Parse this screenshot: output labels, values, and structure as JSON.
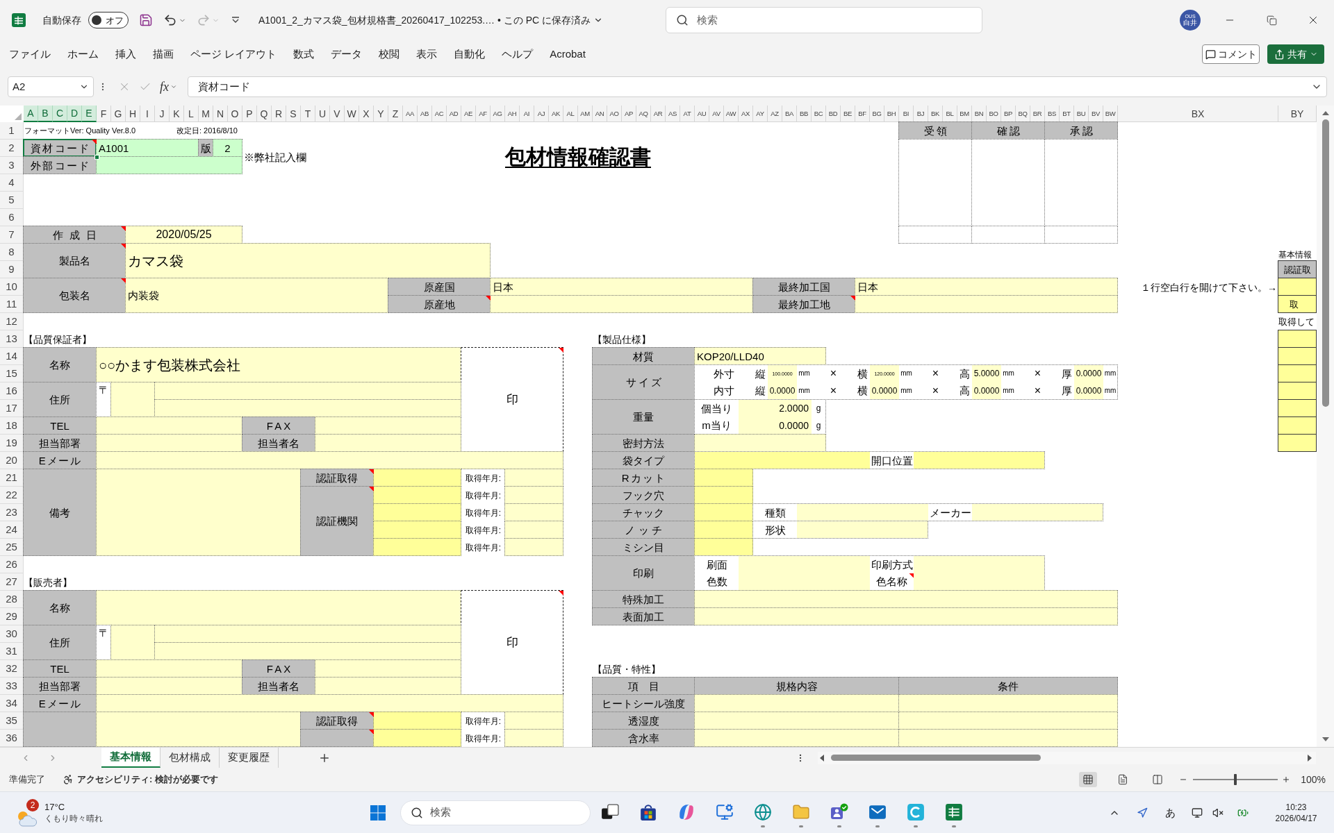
{
  "window": {
    "autosave": {
      "label": "自動保存",
      "toggle_label": "オフ",
      "on": false
    },
    "redo": {
      "disabled": true
    },
    "title": "A1001_2_カマス袋_包材規格書_20260417_102253.… • この PC に保存済み",
    "search_placeholder": "検索",
    "avatar": {
      "initials": "OUS",
      "name": "白井"
    }
  },
  "ribbon": {
    "tabs": [
      "ファイル",
      "ホーム",
      "挿入",
      "描画",
      "ページ レイアウト",
      "数式",
      "データ",
      "校閲",
      "表示",
      "自動化",
      "ヘルプ",
      "Acrobat"
    ],
    "comment_button": "コメント",
    "share_button": "共有"
  },
  "formula_bar": {
    "name_box": "A2",
    "edit_disabled": true,
    "function_label": "fx",
    "formula": "資材コード"
  },
  "column_headers": [
    {
      "label": "A",
      "selected": true
    },
    {
      "label": "B",
      "selected": true
    },
    {
      "label": "C",
      "selected": true
    },
    {
      "label": "D",
      "selected": true
    },
    {
      "label": "E",
      "selected": true
    },
    {
      "label": "F",
      "selected": false
    },
    {
      "label": "G",
      "selected": false
    },
    {
      "label": "H",
      "selected": false
    },
    {
      "label": "I",
      "selected": false
    },
    {
      "label": "J",
      "selected": false
    },
    {
      "label": "K",
      "selected": false
    },
    {
      "label": "L",
      "selected": false
    },
    {
      "label": "M",
      "selected": false
    },
    {
      "label": "N",
      "selected": false
    },
    {
      "label": "O",
      "selected": false
    },
    {
      "label": "P",
      "selected": false
    },
    {
      "label": "Q",
      "selected": false
    },
    {
      "label": "R",
      "selected": false
    },
    {
      "label": "S",
      "selected": false
    },
    {
      "label": "T",
      "selected": false
    },
    {
      "label": "U",
      "selected": false
    },
    {
      "label": "V",
      "selected": false
    },
    {
      "label": "W",
      "selected": false
    },
    {
      "label": "X",
      "selected": false
    },
    {
      "label": "Y",
      "selected": false
    },
    {
      "label": "Z",
      "selected": false
    },
    {
      "label": "AA",
      "selected": false
    },
    {
      "label": "AB",
      "selected": false
    },
    {
      "label": "AC",
      "selected": false
    },
    {
      "label": "AD",
      "selected": false
    },
    {
      "label": "AE",
      "selected": false
    },
    {
      "label": "AF",
      "selected": false
    },
    {
      "label": "AG",
      "selected": false
    },
    {
      "label": "AH",
      "selected": false
    },
    {
      "label": "AI",
      "selected": false
    },
    {
      "label": "AJ",
      "selected": false
    },
    {
      "label": "AK",
      "selected": false
    },
    {
      "label": "AL",
      "selected": false
    },
    {
      "label": "AM",
      "selected": false
    },
    {
      "label": "AN",
      "selected": false
    },
    {
      "label": "AO",
      "selected": false
    },
    {
      "label": "AP",
      "selected": false
    },
    {
      "label": "AQ",
      "selected": false
    },
    {
      "label": "AR",
      "selected": false
    },
    {
      "label": "AS",
      "selected": false
    },
    {
      "label": "AT",
      "selected": false
    },
    {
      "label": "AU",
      "selected": false
    },
    {
      "label": "AV",
      "selected": false
    },
    {
      "label": "AW",
      "selected": false
    },
    {
      "label": "AX",
      "selected": false
    },
    {
      "label": "AY",
      "selected": false
    },
    {
      "label": "AZ",
      "selected": false
    },
    {
      "label": "BA",
      "selected": false
    },
    {
      "label": "BB",
      "selected": false
    },
    {
      "label": "BC",
      "selected": false
    },
    {
      "label": "BD",
      "selected": false
    },
    {
      "label": "BE",
      "selected": false
    },
    {
      "label": "BF",
      "selected": false
    },
    {
      "label": "BG",
      "selected": false
    },
    {
      "label": "BH",
      "selected": false
    },
    {
      "label": "BI",
      "selected": false
    },
    {
      "label": "BJ",
      "selected": false
    },
    {
      "label": "BK",
      "selected": false
    },
    {
      "label": "BL",
      "selected": false
    },
    {
      "label": "BM",
      "selected": false
    },
    {
      "label": "BN",
      "selected": false
    },
    {
      "label": "BO",
      "selected": false
    },
    {
      "label": "BP",
      "selected": false
    },
    {
      "label": "BQ",
      "selected": false
    },
    {
      "label": "BR",
      "selected": false
    },
    {
      "label": "BS",
      "selected": false
    },
    {
      "label": "BT",
      "selected": false
    },
    {
      "label": "BU",
      "selected": false
    },
    {
      "label": "BV",
      "selected": false
    },
    {
      "label": "BW",
      "selected": false
    },
    {
      "label": "BX",
      "selected": false
    },
    {
      "label": "BY",
      "selected": false
    }
  ],
  "row_headers": [
    "1",
    "2",
    "3",
    "4",
    "5",
    "6",
    "7",
    "8",
    "9",
    "10",
    "11",
    "12",
    "13",
    "14",
    "15",
    "16",
    "17",
    "18",
    "19",
    "20",
    "21",
    "22",
    "23",
    "24",
    "25",
    "26",
    "27",
    "28",
    "29",
    "30",
    "31",
    "32",
    "33",
    "34",
    "35",
    "36"
  ],
  "sheet": {
    "format_version": "フォーマットVer: Quality Ver.8.0",
    "revision_date": "改定日: 2016/8/10",
    "material_code": {
      "label": "資材コード",
      "value": "A1001",
      "selected": true,
      "comment": true
    },
    "edition": {
      "label": "版",
      "value": "2"
    },
    "external_code": {
      "label": "外部コード"
    },
    "internal_note": "※弊社記入欄",
    "title": "包材情報確認書",
    "approval_columns": [
      "受領",
      "確認",
      "承認"
    ],
    "created_date": {
      "label": "作成日",
      "value": "2020/05/25",
      "comment": true
    },
    "product_name": {
      "label": "製品名",
      "value": "カマス袋",
      "comment": true
    },
    "package_name": {
      "label": "包装名",
      "value": "内装袋",
      "comment": true
    },
    "origin_country": {
      "label": "原産国",
      "value": "日本"
    },
    "origin_place": {
      "label": "原産地",
      "comment": true
    },
    "final_country": {
      "label": "最終加工国",
      "value": "日本"
    },
    "final_place": {
      "label": "最終加工地",
      "comment": true
    },
    "blank_row_note": "１行空白行を開けて下さい。→",
    "side_panel": {
      "title": "基本情報",
      "header": "認証取",
      "acquired_label": "取",
      "note": "取得して"
    },
    "quality_guarantor": {
      "heading": "【品質保証者】",
      "name": {
        "label": "名称",
        "value": "○○かます包装株式会社"
      },
      "seal": {
        "label": "印",
        "comment": true
      },
      "address": {
        "label": "住所",
        "postal_mark": "〒"
      },
      "tel": {
        "label": "TEL"
      },
      "fax": {
        "label": "FAX"
      },
      "department": {
        "label": "担当部署"
      },
      "person": {
        "label": "担当者名"
      },
      "email": {
        "label": "Eメール"
      },
      "remarks": {
        "label": "備考"
      },
      "certification": {
        "label": "認証取得",
        "comment": true
      },
      "certification_body": {
        "label": "認証機関",
        "comment": true
      },
      "acquired_labels": [
        "取得年月:",
        "取得年月:",
        "取得年月:",
        "取得年月:",
        "取得年月:"
      ]
    },
    "seller": {
      "heading": "【販売者】",
      "name": {
        "label": "名称"
      },
      "seal": {
        "label": "印",
        "comment": true
      },
      "address": {
        "label": "住所",
        "postal_mark": "〒"
      },
      "tel": {
        "label": "TEL"
      },
      "fax": {
        "label": "FAX"
      },
      "department": {
        "label": "担当部署"
      },
      "person": {
        "label": "担当者名"
      },
      "email": {
        "label": "Eメール"
      },
      "certification": {
        "label": "認証取得",
        "comment": true
      },
      "certification_body": {
        "comment": true
      },
      "acquired_labels": [
        "取得年月:",
        "取得年月:"
      ]
    },
    "product_spec": {
      "heading": "【製品仕様】",
      "material": {
        "label": "材質",
        "value": "KOP20/LLD40"
      },
      "size": {
        "label": "サイズ",
        "rows": [
          {
            "label": "外寸",
            "dims": [
              {
                "axis": "縦",
                "value": "100.0000",
                "unit": "mm",
                "separator": "×"
              },
              {
                "axis": "横",
                "value": "120.0000",
                "unit": "mm",
                "separator": "×"
              },
              {
                "axis": "高",
                "value": "5.0000",
                "unit": "mm",
                "separator": "×"
              },
              {
                "axis": "厚",
                "value": "0.0000",
                "unit": "mm"
              }
            ]
          },
          {
            "label": "内寸",
            "dims": [
              {
                "axis": "縦",
                "value": "0.0000",
                "unit": "mm",
                "separator": "×"
              },
              {
                "axis": "横",
                "value": "0.0000",
                "unit": "mm",
                "separator": "×"
              },
              {
                "axis": "高",
                "value": "0.0000",
                "unit": "mm",
                "separator": "×"
              },
              {
                "axis": "厚",
                "value": "0.0000",
                "unit": "mm"
              }
            ]
          }
        ]
      },
      "weight": {
        "label": "重量",
        "rows": [
          {
            "label": "個当り",
            "value": "2.0000",
            "unit": "g"
          },
          {
            "label": "m当り",
            "value": "0.0000",
            "unit": "g"
          }
        ]
      },
      "sealing": {
        "label": "密封方法"
      },
      "bag_type": {
        "label": "袋タイプ",
        "opening_label": "開口位置"
      },
      "r_cut": {
        "label": "Rカット"
      },
      "hook_hole": {
        "label": "フック穴"
      },
      "zipper": {
        "label": "チャック",
        "type_label": "種類",
        "maker_label": "メーカー"
      },
      "notch": {
        "label": "ノッチ",
        "shape_label": "形状"
      },
      "perforation": {
        "label": "ミシン目"
      },
      "printing": {
        "label": "印刷",
        "rows": [
          {
            "left_label": "刷面",
            "right_label": "印刷方式"
          },
          {
            "left_label": "色数",
            "right_label": "色名称",
            "right_comment": true
          }
        ]
      },
      "special_processing": {
        "label": "特殊加工"
      },
      "surface_processing": {
        "label": "表面加工"
      }
    },
    "quality_properties": {
      "heading": "【品質・特性】",
      "columns": [
        "項　目",
        "規格内容",
        "条件"
      ],
      "rows": [
        {
          "item": "ヒートシール強度"
        },
        {
          "item": "透湿度"
        },
        {
          "item": "含水率"
        }
      ]
    }
  },
  "sheet_tabs": [
    {
      "label": "基本情報",
      "selected": true
    },
    {
      "label": "包材構成",
      "selected": false
    },
    {
      "label": "変更履歴",
      "selected": false
    }
  ],
  "status_bar": {
    "ready": "準備完了",
    "accessibility": "アクセシビリティ: 検討が必要です",
    "views": [
      {
        "kind": "normal",
        "selected": true
      },
      {
        "kind": "page_layout",
        "selected": false
      },
      {
        "kind": "page_break",
        "selected": false
      }
    ],
    "zoom": {
      "level": 0.5,
      "reading": "100%"
    }
  },
  "taskbar": {
    "weather": {
      "badge": "2",
      "temperature": "17°C",
      "condition": "くもり時々晴れ"
    },
    "search_placeholder": "検索",
    "apps": [
      {
        "kind": "task_view",
        "running": false
      },
      {
        "kind": "store",
        "running": false
      },
      {
        "kind": "assistant",
        "running": false
      },
      {
        "kind": "remote_desktop",
        "running": false
      },
      {
        "kind": "browser",
        "running": true
      },
      {
        "kind": "files",
        "running": true
      },
      {
        "kind": "chat",
        "running": true
      },
      {
        "kind": "mail",
        "running": true
      },
      {
        "kind": "c_app",
        "running": true
      },
      {
        "kind": "spreadsheet",
        "running": true
      }
    ],
    "ime": "あ",
    "time": "10:23",
    "date": "2026/04/17"
  }
}
